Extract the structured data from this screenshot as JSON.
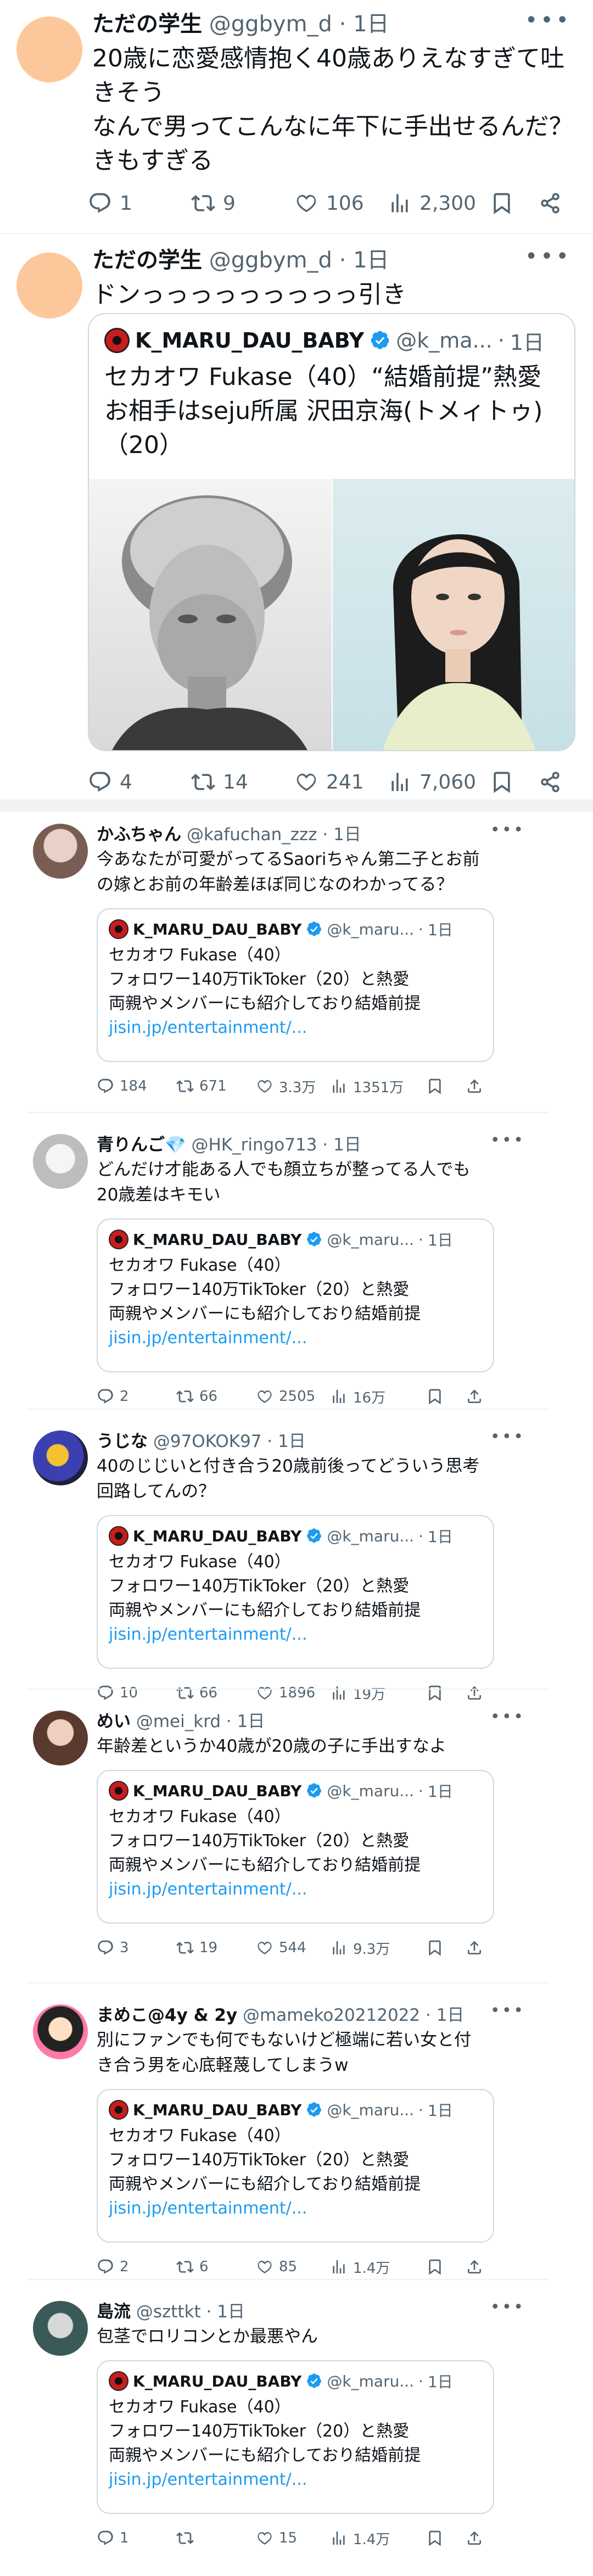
{
  "tweets": [
    {
      "author": "ただの学生",
      "handle": "@ggbym_d",
      "time": "1日",
      "text_lines": [
        "20歳に恋愛感情抱く40歳ありえなすぎて吐",
        "きそう",
        "なんで男ってこんなに年下に手出せるんだ？",
        "きもすぎる"
      ],
      "replies": "1",
      "retweets": "9",
      "likes": "106",
      "views": "2,300"
    },
    {
      "author": "ただの学生",
      "handle": "@ggbym_d",
      "time": "1日",
      "text_lines": [
        "ドンっっっっっっっっっ引き"
      ],
      "quote": {
        "name": "K_MARU_DAU_BABY",
        "handle": "@k_ma...",
        "time": "1日",
        "text_lines": [
          "セカオワ Fukase（40）“結婚前提”熱愛",
          "お相手はseju所属 沢田京海(トメィトゥ)",
          "（20）"
        ]
      },
      "replies": "4",
      "retweets": "14",
      "likes": "241",
      "views": "7,060"
    }
  ],
  "quoted_card": {
    "name": "K_MARU_DAU_BABY",
    "handle": "@k_maru...",
    "time": "1日",
    "lines": [
      "セカオワ Fukase（40）",
      "フォロワー140万TikToker（20）と熱愛",
      "両親やメンバーにも紹介しており結婚前提"
    ],
    "link": "jisin.jp/entertainment/..."
  },
  "replies": [
    {
      "name": "かふちゃん",
      "handle": "@kafuchan_zzz",
      "time": "1日",
      "text_lines": [
        "今あなたが可愛がってるSaoriちゃん第二子とお前",
        "の嫁とお前の年齢差ほぼ同じなのわかってる？"
      ],
      "replies": "184",
      "retweets": "671",
      "likes": "3.3万",
      "views": "1351万"
    },
    {
      "name": "青りんご💎",
      "handle": "@HK_ringo713",
      "time": "1日",
      "text_lines": [
        "どんだけ才能ある人でも顔立ちが整ってる人でも",
        "20歳差はキモい"
      ],
      "replies": "2",
      "retweets": "66",
      "likes": "2505",
      "views": "16万"
    },
    {
      "name": "うじな",
      "handle": "@97OKOK97",
      "time": "1日",
      "text_lines": [
        "40のじじいと付き合う20歳前後ってどういう思考",
        "回路してんの？"
      ],
      "replies": "10",
      "retweets": "66",
      "likes": "1896",
      "views": "19万"
    },
    {
      "name": "めい",
      "handle": "@mei_krd",
      "time": "1日",
      "text_lines": [
        "年齢差というか40歳が20歳の子に手出すなよ"
      ],
      "replies": "3",
      "retweets": "19",
      "likes": "544",
      "views": "9.3万"
    },
    {
      "name": "まめこ@4y & 2y",
      "handle": "@mameko20212022",
      "time": "1日",
      "text_lines": [
        "別にファンでも何でもないけど極端に若い女と付",
        "き合う男を心底軽蔑してしまうw"
      ],
      "replies": "2",
      "retweets": "6",
      "likes": "85",
      "views": "1.4万"
    },
    {
      "name": "島流",
      "handle": "@szttkt",
      "time": "1日",
      "text_lines": [
        "包茎でロリコンとか最悪やん"
      ],
      "replies": "1",
      "retweets": "",
      "likes": "15",
      "views": "1.4万"
    }
  ],
  "colors": {
    "text": "#0f1419",
    "muted": "#536471",
    "link": "#1d9bf0",
    "verified": "#1d9bf0",
    "border": "#cfd9de"
  }
}
